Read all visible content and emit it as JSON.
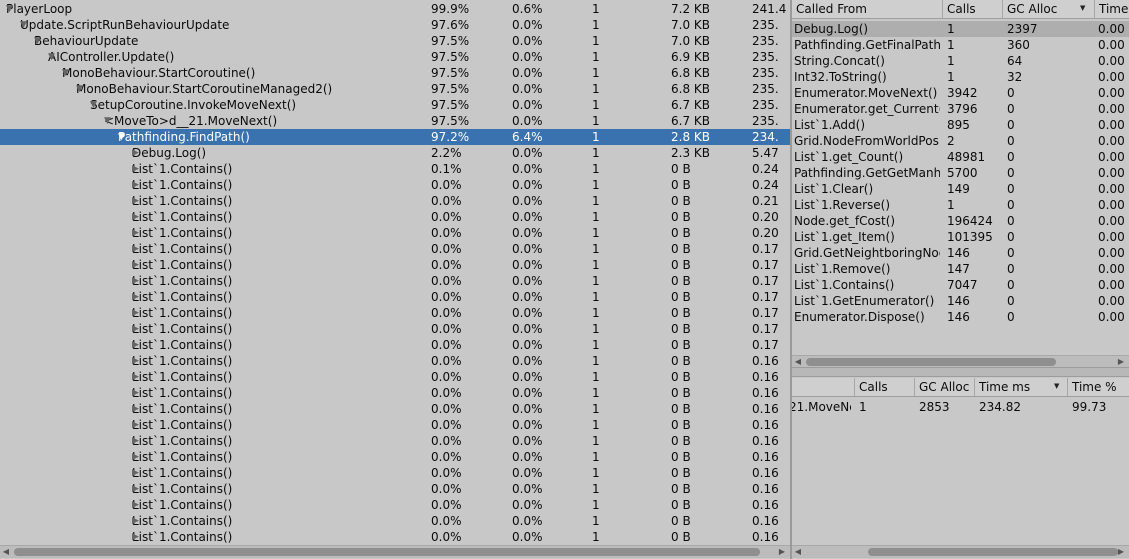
{
  "hierarchy": {
    "rows": [
      {
        "name": "PlayerLoop",
        "total": "99.9%",
        "self": "0.6%",
        "calls": "1",
        "gc": "7.2 KB",
        "time": "241.4",
        "depth": 0,
        "expanded": true
      },
      {
        "name": "Update.ScriptRunBehaviourUpdate",
        "total": "97.6%",
        "self": "0.0%",
        "calls": "1",
        "gc": "7.0 KB",
        "time": "235.",
        "depth": 1,
        "expanded": true
      },
      {
        "name": "BehaviourUpdate",
        "total": "97.5%",
        "self": "0.0%",
        "calls": "1",
        "gc": "7.0 KB",
        "time": "235.",
        "depth": 2,
        "expanded": true
      },
      {
        "name": "AIController.Update()",
        "total": "97.5%",
        "self": "0.0%",
        "calls": "1",
        "gc": "6.9 KB",
        "time": "235.",
        "depth": 3,
        "expanded": true
      },
      {
        "name": "MonoBehaviour.StartCoroutine()",
        "total": "97.5%",
        "self": "0.0%",
        "calls": "1",
        "gc": "6.8 KB",
        "time": "235.",
        "depth": 4,
        "expanded": true
      },
      {
        "name": "MonoBehaviour.StartCoroutineManaged2()",
        "total": "97.5%",
        "self": "0.0%",
        "calls": "1",
        "gc": "6.8 KB",
        "time": "235.",
        "depth": 5,
        "expanded": true
      },
      {
        "name": "SetupCoroutine.InvokeMoveNext()",
        "total": "97.5%",
        "self": "0.0%",
        "calls": "1",
        "gc": "6.7 KB",
        "time": "235.",
        "depth": 6,
        "expanded": true
      },
      {
        "name": "<MoveTo>d__21.MoveNext()",
        "total": "97.5%",
        "self": "0.0%",
        "calls": "1",
        "gc": "6.7 KB",
        "time": "235.",
        "depth": 7,
        "expanded": true
      },
      {
        "name": "Pathfinding.FindPath()",
        "total": "97.2%",
        "self": "6.4%",
        "calls": "1",
        "gc": "2.8 KB",
        "time": "234.",
        "depth": 8,
        "expanded": true,
        "selected": true
      },
      {
        "name": "Debug.Log()",
        "total": "2.2%",
        "self": "0.0%",
        "calls": "1",
        "gc": "2.3 KB",
        "time": "5.47",
        "depth": 9,
        "expanded": false
      },
      {
        "name": "List`1.Contains()",
        "total": "0.1%",
        "self": "0.0%",
        "calls": "1",
        "gc": "0 B",
        "time": "0.24",
        "depth": 9,
        "expanded": false
      },
      {
        "name": "List`1.Contains()",
        "total": "0.0%",
        "self": "0.0%",
        "calls": "1",
        "gc": "0 B",
        "time": "0.24",
        "depth": 9,
        "expanded": false
      },
      {
        "name": "List`1.Contains()",
        "total": "0.0%",
        "self": "0.0%",
        "calls": "1",
        "gc": "0 B",
        "time": "0.21",
        "depth": 9,
        "expanded": false
      },
      {
        "name": "List`1.Contains()",
        "total": "0.0%",
        "self": "0.0%",
        "calls": "1",
        "gc": "0 B",
        "time": "0.20",
        "depth": 9,
        "expanded": false
      },
      {
        "name": "List`1.Contains()",
        "total": "0.0%",
        "self": "0.0%",
        "calls": "1",
        "gc": "0 B",
        "time": "0.20",
        "depth": 9,
        "expanded": false
      },
      {
        "name": "List`1.Contains()",
        "total": "0.0%",
        "self": "0.0%",
        "calls": "1",
        "gc": "0 B",
        "time": "0.17",
        "depth": 9,
        "expanded": false
      },
      {
        "name": "List`1.Contains()",
        "total": "0.0%",
        "self": "0.0%",
        "calls": "1",
        "gc": "0 B",
        "time": "0.17",
        "depth": 9,
        "expanded": false
      },
      {
        "name": "List`1.Contains()",
        "total": "0.0%",
        "self": "0.0%",
        "calls": "1",
        "gc": "0 B",
        "time": "0.17",
        "depth": 9,
        "expanded": false
      },
      {
        "name": "List`1.Contains()",
        "total": "0.0%",
        "self": "0.0%",
        "calls": "1",
        "gc": "0 B",
        "time": "0.17",
        "depth": 9,
        "expanded": false
      },
      {
        "name": "List`1.Contains()",
        "total": "0.0%",
        "self": "0.0%",
        "calls": "1",
        "gc": "0 B",
        "time": "0.17",
        "depth": 9,
        "expanded": false
      },
      {
        "name": "List`1.Contains()",
        "total": "0.0%",
        "self": "0.0%",
        "calls": "1",
        "gc": "0 B",
        "time": "0.17",
        "depth": 9,
        "expanded": false
      },
      {
        "name": "List`1.Contains()",
        "total": "0.0%",
        "self": "0.0%",
        "calls": "1",
        "gc": "0 B",
        "time": "0.17",
        "depth": 9,
        "expanded": false
      },
      {
        "name": "List`1.Contains()",
        "total": "0.0%",
        "self": "0.0%",
        "calls": "1",
        "gc": "0 B",
        "time": "0.16",
        "depth": 9,
        "expanded": false
      },
      {
        "name": "List`1.Contains()",
        "total": "0.0%",
        "self": "0.0%",
        "calls": "1",
        "gc": "0 B",
        "time": "0.16",
        "depth": 9,
        "expanded": false
      },
      {
        "name": "List`1.Contains()",
        "total": "0.0%",
        "self": "0.0%",
        "calls": "1",
        "gc": "0 B",
        "time": "0.16",
        "depth": 9,
        "expanded": false
      },
      {
        "name": "List`1.Contains()",
        "total": "0.0%",
        "self": "0.0%",
        "calls": "1",
        "gc": "0 B",
        "time": "0.16",
        "depth": 9,
        "expanded": false
      },
      {
        "name": "List`1.Contains()",
        "total": "0.0%",
        "self": "0.0%",
        "calls": "1",
        "gc": "0 B",
        "time": "0.16",
        "depth": 9,
        "expanded": false
      },
      {
        "name": "List`1.Contains()",
        "total": "0.0%",
        "self": "0.0%",
        "calls": "1",
        "gc": "0 B",
        "time": "0.16",
        "depth": 9,
        "expanded": false
      },
      {
        "name": "List`1.Contains()",
        "total": "0.0%",
        "self": "0.0%",
        "calls": "1",
        "gc": "0 B",
        "time": "0.16",
        "depth": 9,
        "expanded": false
      },
      {
        "name": "List`1.Contains()",
        "total": "0.0%",
        "self": "0.0%",
        "calls": "1",
        "gc": "0 B",
        "time": "0.16",
        "depth": 9,
        "expanded": false
      },
      {
        "name": "List`1.Contains()",
        "total": "0.0%",
        "self": "0.0%",
        "calls": "1",
        "gc": "0 B",
        "time": "0.16",
        "depth": 9,
        "expanded": false
      },
      {
        "name": "List`1.Contains()",
        "total": "0.0%",
        "self": "0.0%",
        "calls": "1",
        "gc": "0 B",
        "time": "0.16",
        "depth": 9,
        "expanded": false
      },
      {
        "name": "List`1.Contains()",
        "total": "0.0%",
        "self": "0.0%",
        "calls": "1",
        "gc": "0 B",
        "time": "0.16",
        "depth": 9,
        "expanded": false
      },
      {
        "name": "List`1.Contains()",
        "total": "0.0%",
        "self": "0.0%",
        "calls": "1",
        "gc": "0 B",
        "time": "0.16",
        "depth": 9,
        "expanded": false
      }
    ]
  },
  "called_from": {
    "headers": [
      "Called From",
      "Calls",
      "GC Alloc",
      "Time"
    ],
    "rows": [
      {
        "name": "Debug.Log()",
        "calls": "1",
        "gc": "2397",
        "time": "0.00",
        "selected": true
      },
      {
        "name": "Pathfinding.GetFinalPath()",
        "calls": "1",
        "gc": "360",
        "time": "0.00"
      },
      {
        "name": "String.Concat()",
        "calls": "1",
        "gc": "64",
        "time": "0.00"
      },
      {
        "name": "Int32.ToString()",
        "calls": "1",
        "gc": "32",
        "time": "0.00"
      },
      {
        "name": "Enumerator.MoveNext()",
        "calls": "3942",
        "gc": "0",
        "time": "0.00"
      },
      {
        "name": "Enumerator.get_Current()",
        "calls": "3796",
        "gc": "0",
        "time": "0.00"
      },
      {
        "name": "List`1.Add()",
        "calls": "895",
        "gc": "0",
        "time": "0.00"
      },
      {
        "name": "Grid.NodeFromWorldPositi",
        "calls": "2",
        "gc": "0",
        "time": "0.00"
      },
      {
        "name": "List`1.get_Count()",
        "calls": "48981",
        "gc": "0",
        "time": "0.00"
      },
      {
        "name": "Pathfinding.GetGetManha",
        "calls": "5700",
        "gc": "0",
        "time": "0.00"
      },
      {
        "name": "List`1.Clear()",
        "calls": "149",
        "gc": "0",
        "time": "0.00"
      },
      {
        "name": "List`1.Reverse()",
        "calls": "1",
        "gc": "0",
        "time": "0.00"
      },
      {
        "name": "Node.get_fCost()",
        "calls": "196424",
        "gc": "0",
        "time": "0.00"
      },
      {
        "name": "List`1.get_Item()",
        "calls": "101395",
        "gc": "0",
        "time": "0.00"
      },
      {
        "name": "Grid.GetNeightboringNode",
        "calls": "146",
        "gc": "0",
        "time": "0.00"
      },
      {
        "name": "List`1.Remove()",
        "calls": "147",
        "gc": "0",
        "time": "0.00"
      },
      {
        "name": "List`1.Contains()",
        "calls": "7047",
        "gc": "0",
        "time": "0.00"
      },
      {
        "name": "List`1.GetEnumerator()",
        "calls": "146",
        "gc": "0",
        "time": "0.00"
      },
      {
        "name": "Enumerator.Dispose()",
        "calls": "146",
        "gc": "0",
        "time": "0.00"
      }
    ]
  },
  "calls_to": {
    "headers": [
      "",
      "Calls",
      "GC Alloc",
      "Time ms",
      "Time %"
    ],
    "rows": [
      {
        "name": "21.MoveNe:",
        "calls": "1",
        "gc": "2853",
        "time_ms": "234.82",
        "time_pct": "99.73"
      }
    ]
  },
  "icons": {
    "collapse": "triangle-down",
    "expand": "triangle-right",
    "sort": "sort-desc-icon"
  }
}
